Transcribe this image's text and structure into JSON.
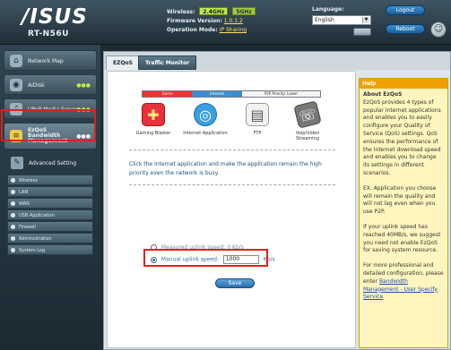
{
  "brand": {
    "logo": "/ISUS",
    "model": "RT-N56U"
  },
  "status": {
    "wireless_label": "Wireless:",
    "band_24": "2.4GHz",
    "band_5": "5GHz",
    "firmware_label": "Firmware Version:",
    "firmware_value": "1.0.1.2",
    "opmode_label": "Operation Mode:",
    "opmode_value": "IP Sharing"
  },
  "language": {
    "label": "Language:",
    "value": "English"
  },
  "header_buttons": {
    "logout": "Logout",
    "reboot": "Reboot"
  },
  "sidebar": {
    "items": [
      {
        "label": "Network Map",
        "icon": "network-map-icon"
      },
      {
        "label": "AiDisk",
        "icon": "aidisk-icon"
      },
      {
        "label": "UPnP Media Server",
        "icon": "media-server-icon"
      },
      {
        "label_line1": "EzQoS",
        "label_line2": "Bandwidth",
        "label_line3": "Management",
        "icon": "ezqos-icon",
        "active": true
      },
      {
        "label": "Advanced Setting",
        "icon": "wrench-icon"
      }
    ],
    "sub_items": [
      "Wireless",
      "LAN",
      "WAN",
      "USB Application",
      "Firewall",
      "Administration",
      "System Log"
    ]
  },
  "tabs": [
    "EZQoS",
    "Traffic Monitor"
  ],
  "priority_bar": {
    "seg1": "Game",
    "seg2": "Internet",
    "seg3": "P2P Priority: Lower"
  },
  "apps": [
    {
      "label": "Gaming Blaster",
      "icon": "gamepad-icon"
    },
    {
      "label": "Internet Application",
      "icon": "globe-icon"
    },
    {
      "label": "FTP",
      "icon": "ftp-drive-icon"
    },
    {
      "label_line1": "Voip/Video",
      "label_line2": "Streaming",
      "icon": "phone-icon"
    }
  ],
  "description": "Click the Internet application and make the application remain the high priority even the network is busy.",
  "uplink": {
    "measured_label": "Measured uplink speed: 0 Kb/s",
    "manual_label": "Manual uplink speed:",
    "manual_value": "1000",
    "unit": "Kb/s"
  },
  "save_label": "Save",
  "help": {
    "header": "Help",
    "title": "About EzQoS",
    "p1": "EzQoS provides 4 types of popular Internet applications and enables you to easily configure your Quality of Service (QoS) settings. QoS ensures the performance of the Internet download speed and enables you to change its settings in different scenarios.",
    "p2": "EX. Application you choose will remain the quality and will not lag even when you use P2P.",
    "p3": "If your uplink speed has reached 40MB/s, we suggest you need not enable EzQoS for saving system resource.",
    "p4": "For more professional and detailed configuration, please enter",
    "p4_link": "Bandwidth Management - User Specify Service"
  }
}
